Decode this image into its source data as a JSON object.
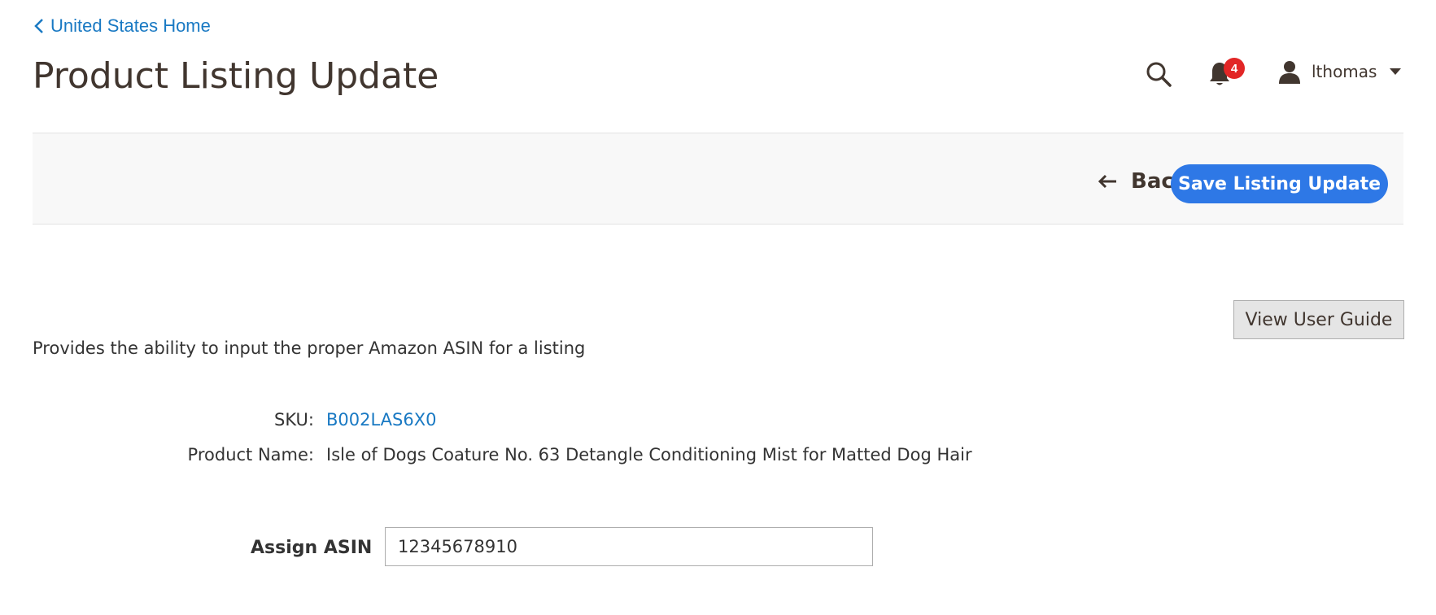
{
  "breadcrumb": {
    "label": "United States Home"
  },
  "page": {
    "title": "Product Listing Update"
  },
  "header": {
    "notifications": {
      "count": "4",
      "icon": "bell-icon"
    },
    "search": {
      "icon": "search-icon"
    },
    "user": {
      "name": "lthomas",
      "icon": "user-icon"
    }
  },
  "actionbar": {
    "back_label": "Back",
    "save_label": "Save Listing Update"
  },
  "main": {
    "guide_button": "View User Guide",
    "description": "Provides the ability to input the proper Amazon ASIN for a listing",
    "sku_label": "SKU:",
    "sku_value": "B002LAS6X0",
    "product_name_label": "Product Name:",
    "product_name_value": "Isle of Dogs Coature No. 63 Detangle Conditioning Mist for Matted Dog Hair",
    "asin_label": "Assign ASIN",
    "asin_value": "12345678910"
  },
  "colors": {
    "link": "#1979c3",
    "primary_button": "#2e78e6",
    "badge": "#e22626",
    "actionbar_bg": "#f8f8f8"
  }
}
